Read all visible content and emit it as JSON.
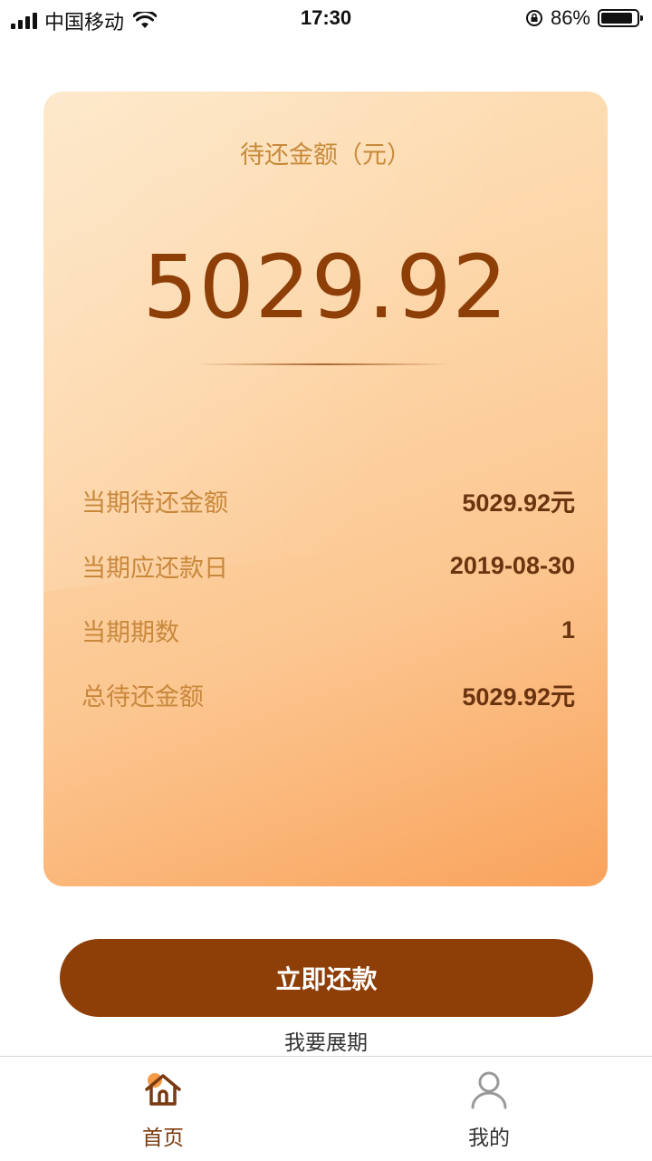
{
  "status_bar": {
    "carrier": "中国移动",
    "time": "17:30",
    "battery_percent": "86%"
  },
  "card": {
    "title": "待还金额（元）",
    "amount": "5029.92",
    "details": [
      {
        "label": "当期待还金额",
        "value": "5029.92元"
      },
      {
        "label": "当期应还款日",
        "value": "2019-08-30"
      },
      {
        "label": "当期期数",
        "value": "1"
      },
      {
        "label": "总待还金额",
        "value": "5029.92元"
      }
    ]
  },
  "actions": {
    "pay_now": "立即还款",
    "extend": "我要展期"
  },
  "tabs": [
    {
      "label": "首页",
      "icon": "home-icon",
      "active": true
    },
    {
      "label": "我的",
      "icon": "user-icon",
      "active": false
    }
  ],
  "colors": {
    "primary": "#8e3e07",
    "card_gradient_start": "#fde4c0",
    "card_gradient_end": "#f9a35c",
    "label": "#c8883c"
  }
}
